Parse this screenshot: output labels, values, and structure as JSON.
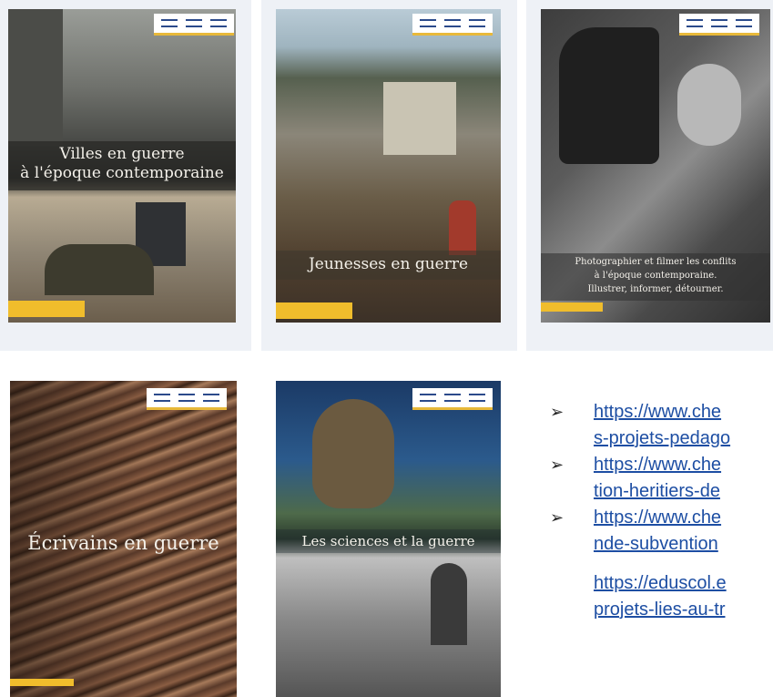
{
  "posters": [
    {
      "title": "Villes en guerre\nà l'époque contemporaine"
    },
    {
      "title": "Jeunesses en guerre"
    },
    {
      "title": "Photographier et filmer les conflits\nà l'époque contemporaine.\nIllustrer, informer, détourner."
    },
    {
      "title": "Écrivains en guerre"
    },
    {
      "title": "Les sciences et la guerre"
    }
  ],
  "links": [
    {
      "line1": "https://www.che",
      "line2": "s-projets-pedago"
    },
    {
      "line1": "https://www.che",
      "line2": "tion-heritiers-de"
    },
    {
      "line1": "https://www.che",
      "line2": "nde-subvention"
    }
  ],
  "extra_link": {
    "line1": "https://eduscol.e",
    "line2": "projets-lies-au-tr"
  },
  "colors": {
    "accent_yellow": "#f0bd2c",
    "link_blue": "#1d4ea3",
    "panel_bg": "#eef1f6"
  }
}
